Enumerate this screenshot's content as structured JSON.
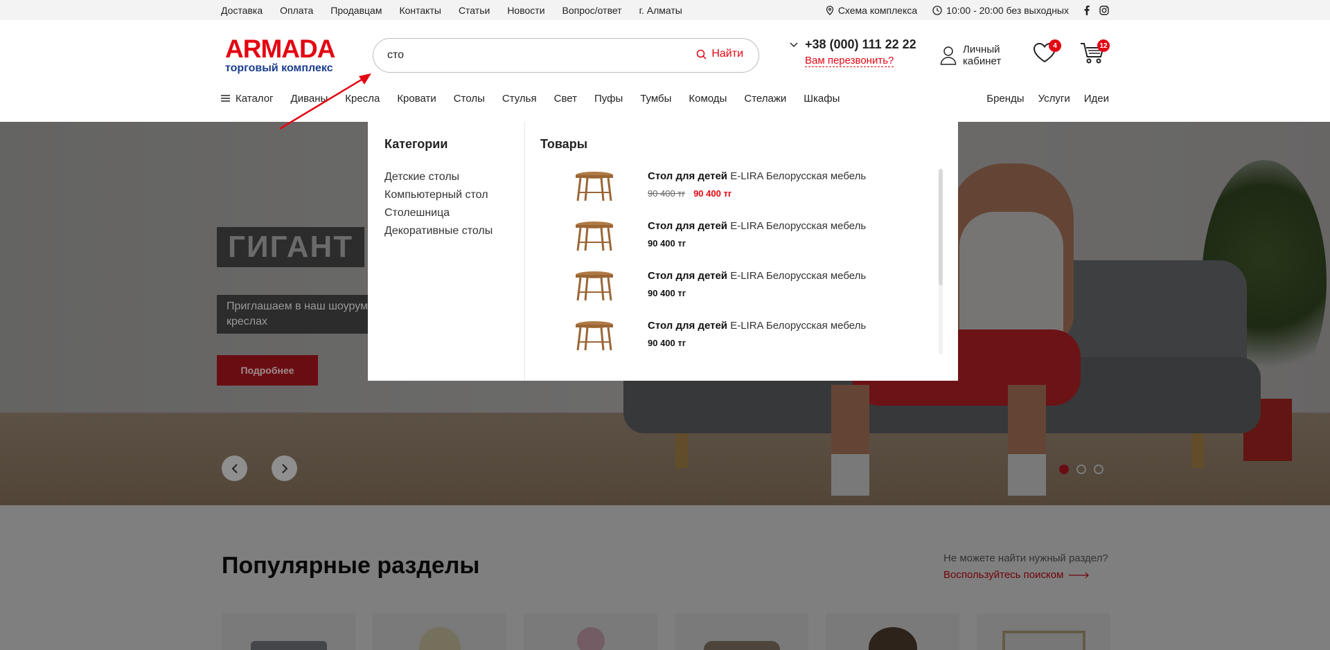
{
  "topbar": {
    "links": [
      "Доставка",
      "Оплата",
      "Продавцам",
      "Контакты",
      "Статьи",
      "Новости",
      "Вопрос/ответ",
      "г. Алматы"
    ],
    "scheme": "Схема комплекса",
    "hours": "10:00 - 20:00 без выходных"
  },
  "logo": {
    "title": "ARMADA",
    "subtitle": "торговый комплекс"
  },
  "search": {
    "value": "сто",
    "button": "Найти"
  },
  "contact": {
    "phone": "+38 (000) 111 22 22",
    "callback": "Вам перезвонить?"
  },
  "account": {
    "line1": "Личный",
    "line2": "кабинет"
  },
  "favorites": {
    "count": "4"
  },
  "cart": {
    "count": "12"
  },
  "nav": {
    "catalog": "Каталог",
    "items": [
      "Диваны",
      "Кресла",
      "Кровати",
      "Столы",
      "Стулья",
      "Свет",
      "Пуфы",
      "Тумбы",
      "Комоды",
      "Стелажи",
      "Шкафы"
    ],
    "right": [
      "Бренды",
      "Услуги",
      "Идеи"
    ]
  },
  "hero": {
    "title": "ГИГАНТ",
    "text": "Приглашаем в наш шоурум креслах",
    "button": "Подробнее"
  },
  "dropdown": {
    "categories_title": "Категории",
    "categories": [
      "Детские столы",
      "Компьютерный стол",
      "Столешница",
      "Декоративные столы"
    ],
    "products_title": "Товары",
    "products": [
      {
        "name": "Стол для детей",
        "brand": "E-LIRA Белорусская мебель",
        "old_price": "90 400 тг",
        "price": "90 400 тг"
      },
      {
        "name": "Стол для детей",
        "brand": "E-LIRA Белорусская мебель",
        "price": "90 400 тг"
      },
      {
        "name": "Стол для детей",
        "brand": "E-LIRA Белорусская мебель",
        "price": "90 400 тг"
      },
      {
        "name": "Стол для детей",
        "brand": "E-LIRA Белорусская мебель",
        "price": "90 400 тг"
      }
    ]
  },
  "popular": {
    "title": "Популярные разделы",
    "hint": "Не можете найти нужный раздел?",
    "hint_link": "Воспользуйтесь поиском"
  },
  "colors": {
    "accent": "#e30613",
    "brand_blue": "#1b3d8f"
  }
}
